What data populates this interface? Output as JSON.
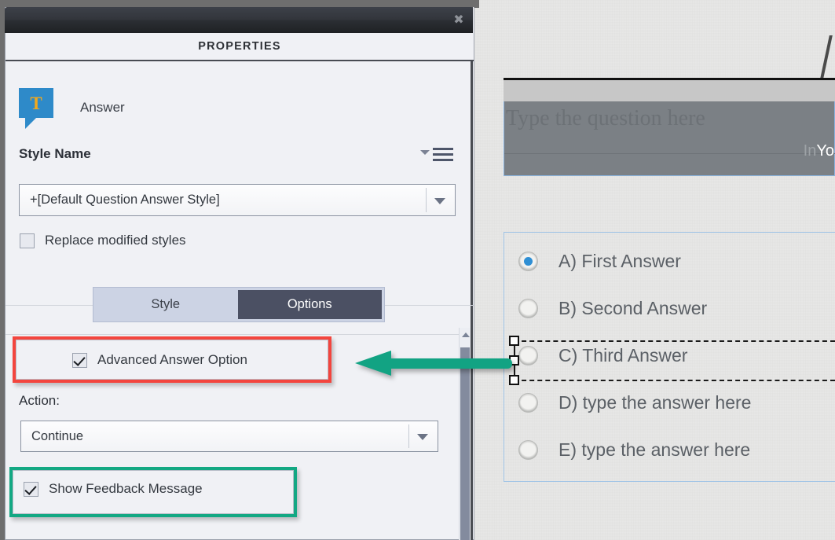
{
  "panel": {
    "title": "PROPERTIES",
    "close_icon": "close-icon",
    "object": {
      "icon": "text-caption-icon",
      "icon_letter": "T",
      "label": "Answer"
    },
    "style_name": {
      "label": "Style Name",
      "menu_icon": "panel-menu-icon",
      "selected_value": "+[Default Question Answer Style]",
      "dropdown_icon": "chevron-down-icon"
    },
    "replace_modified_styles": {
      "label": "Replace modified styles",
      "checked": false
    },
    "tabs": [
      {
        "label": "Style",
        "active": false
      },
      {
        "label": "Options",
        "active": true
      }
    ],
    "advanced_answer_option": {
      "label": "Advanced Answer Option",
      "checked": true
    },
    "action": {
      "label": "Action:",
      "selected_value": "Continue",
      "dropdown_icon": "chevron-down-icon"
    },
    "show_feedback_message": {
      "label": "Show Feedback Message",
      "checked": true
    },
    "scrollbar": {
      "up_arrow_icon": "scroll-up-arrow-icon"
    }
  },
  "annotations": {
    "red_box_color": "#f3453e",
    "teal_box_color": "#13a883",
    "arrow_color": "#12a383",
    "arrow_direction": "left"
  },
  "slide": {
    "question": {
      "placeholder": "Type the question here",
      "corner_text_dim": "In",
      "corner_text_bright": "Yo"
    },
    "answers": [
      {
        "text": "A)  First Answer",
        "selected": true
      },
      {
        "text": "B)  Second Answer",
        "selected": false
      },
      {
        "text": "C)  Third Answer",
        "selected": false
      },
      {
        "text": "D)  type the answer here",
        "selected": false
      },
      {
        "text": "E)  type the answer here",
        "selected": false
      }
    ],
    "selected_answer_index": 2
  }
}
